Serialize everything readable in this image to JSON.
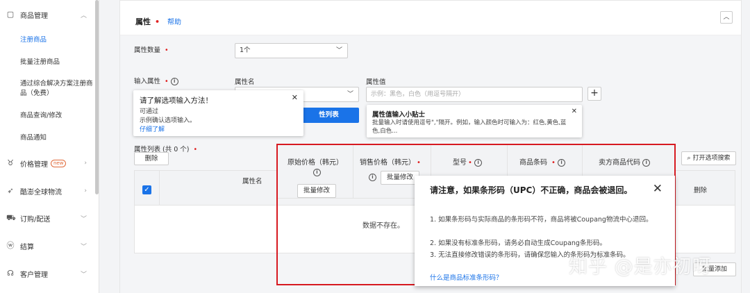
{
  "sidebar": {
    "groups": [
      {
        "label": "商品管理",
        "icon": "box-icon",
        "expanded": true
      },
      {
        "label": "价格管理",
        "icon": "medal-icon",
        "badge": "new"
      },
      {
        "label": "酷澎全球物流",
        "icon": "rocket-icon"
      },
      {
        "label": "订购/配送",
        "icon": "truck-icon"
      },
      {
        "label": "结算",
        "icon": "won-icon"
      },
      {
        "label": "客户管理",
        "icon": "headset-icon"
      }
    ],
    "sub_items": [
      {
        "label": "注册商品",
        "active": true
      },
      {
        "label": "批量注册商品"
      },
      {
        "label": "通过综合解决方案注册商品（免费）"
      },
      {
        "label": "商品查询/修改"
      },
      {
        "label": "商品通知"
      }
    ]
  },
  "panel": {
    "title": "属性",
    "help": "帮助"
  },
  "attr_count": {
    "label": "属性数量",
    "value": "1个"
  },
  "input_attr": {
    "label": "输入属性"
  },
  "attr_name": {
    "label": "属性名"
  },
  "attr_value": {
    "label": "属性值",
    "placeholder": "示例：黑色，白色（用逗号隔开）"
  },
  "popup_method": {
    "title": "请了解选项输入方法！",
    "line1": "可通过",
    "line2": "示例确认选项输入。",
    "link": "仔细了解"
  },
  "popup_tip": {
    "title": "属性值输入小贴士",
    "body": "批量输入时请使用逗号\",\"隔开。例如，输入颜色时可输入为：红色,黄色,蓝色,白色..."
  },
  "attr_list_btn": "性列表",
  "attr_list": {
    "label": "属性列表 (共 0 个)",
    "count": "0",
    "delete": "删除"
  },
  "table": {
    "col_attr_name": "属性名",
    "empty": "数据不存在。",
    "open_search": "打开选项搜索",
    "delete_col": "删除",
    "batch_add": "批量添加"
  },
  "red_columns": [
    {
      "label": "原始价格（韩元）",
      "required": false
    },
    {
      "label": "销售价格（韩元）",
      "required": true
    },
    {
      "label": "型号",
      "required": true
    },
    {
      "label": "商品条码",
      "required": true
    },
    {
      "label": "卖方商品代码",
      "required": false
    }
  ],
  "batch_edit": "批量修改",
  "upc_tip": {
    "title": "请注意，如果条形码（UPC）不正确，商品会被退回。",
    "lines": [
      "1. 如果条形码与实际商品的条形码不符，商品将被Coupang物流中心退回。",
      "2. 如果没有标准条形码，请务必自动生成Coupang条形码。",
      "3. 无法直接修改错误的条形码，请确保您输入的条形码为标准条码。"
    ],
    "link": "什么是商品标准条形码？"
  },
  "watermark": "知乎 @是亦初呀",
  "colors": {
    "accent": "#1a73e8",
    "required": "#e02020",
    "highlight_border": "#d71920"
  }
}
